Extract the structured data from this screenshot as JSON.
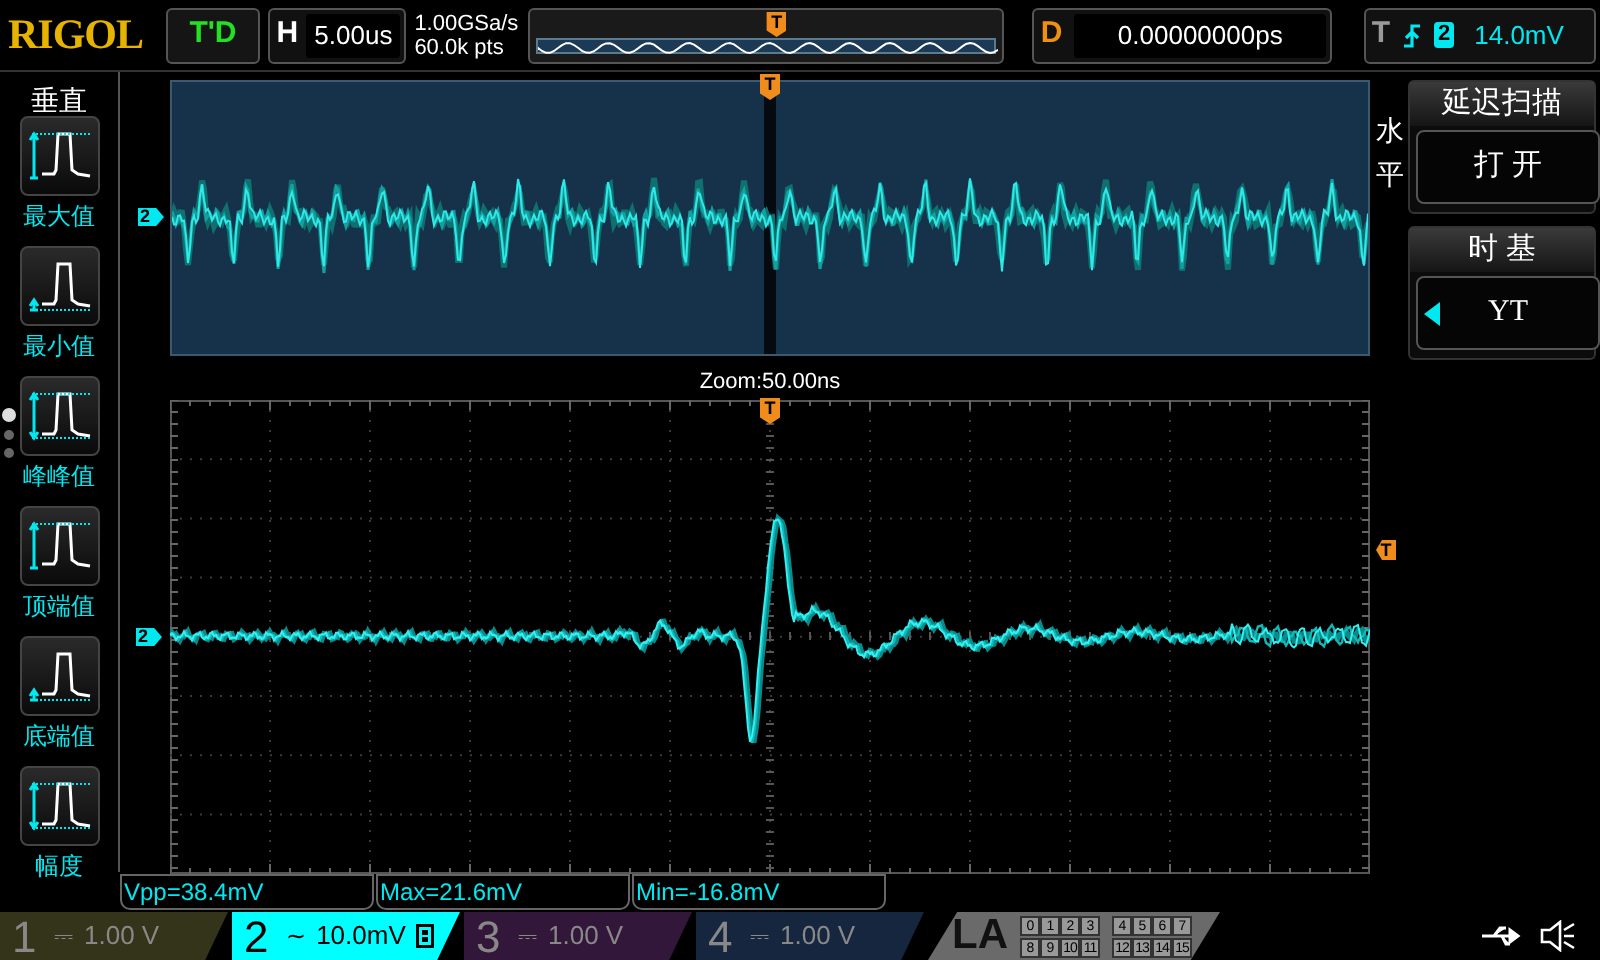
{
  "header": {
    "logo": "RIGOL",
    "run_status": "T'D",
    "timebase": {
      "label": "H",
      "value": "5.00us"
    },
    "sample_rate": "1.00GSa/s",
    "memory_depth": "60.0k pts",
    "delay": {
      "label": "D",
      "value": "0.00000000ps"
    },
    "trigger": {
      "label": "T",
      "channel": "2",
      "level": "14.0mV"
    }
  },
  "memory_bar": {
    "trigger_marker": "T"
  },
  "left_menu": {
    "title": "垂直",
    "page_dots": [
      {
        "selected": true
      },
      {
        "selected": false
      },
      {
        "selected": false
      }
    ],
    "items": [
      {
        "label": "最大值",
        "kind": "max"
      },
      {
        "label": "最小值",
        "kind": "min"
      },
      {
        "label": "峰峰值",
        "kind": "peak"
      },
      {
        "label": "顶端值",
        "kind": "top"
      },
      {
        "label": "底端值",
        "kind": "base"
      },
      {
        "label": "幅度",
        "kind": "amplitude"
      }
    ]
  },
  "zoom_window": {
    "trigger_marker": "T",
    "channel_marker": "2"
  },
  "zoom_label": "Zoom:50.00ns",
  "main_window": {
    "trigger_marker": "T",
    "channel_marker": "2",
    "trigger_level_marker": "T"
  },
  "right_menu": {
    "title": "水平",
    "items": [
      {
        "header": "延迟扫描",
        "value": "打 开",
        "arrow": false
      },
      {
        "header": "时 基",
        "value": "YT",
        "arrow": true
      }
    ]
  },
  "measurements": [
    "Vpp=38.4mV",
    "Max=21.6mV",
    "Min=-16.8mV"
  ],
  "channels": [
    {
      "number": "1",
      "coupling": "⎓",
      "scale": "1.00 V",
      "bw_limit": false,
      "selected": false,
      "color": "#34341a"
    },
    {
      "number": "2",
      "coupling": "~",
      "scale": "10.0mV",
      "bw_limit": true,
      "selected": true,
      "color": "#00ffff"
    },
    {
      "number": "3",
      "coupling": "⎓",
      "scale": "1.00 V",
      "bw_limit": false,
      "selected": false,
      "color": "#33173a"
    },
    {
      "number": "4",
      "coupling": "⎓",
      "scale": "1.00 V",
      "bw_limit": false,
      "selected": false,
      "color": "#16263e"
    }
  ],
  "la": {
    "label": "LA",
    "bits": [
      "0",
      "1",
      "2",
      "3",
      "4",
      "5",
      "6",
      "7",
      "8",
      "9",
      "10",
      "11",
      "12",
      "13",
      "14",
      "15"
    ]
  }
}
